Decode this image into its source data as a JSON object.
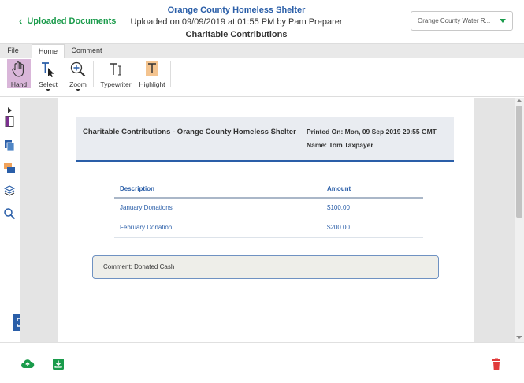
{
  "header": {
    "back_label": "Uploaded Documents",
    "title": "Orange County Homeless Shelter",
    "subtitle": "Uploaded on 09/09/2019 at 01:55 PM by Pam Preparer",
    "category": "Charitable Contributions",
    "dropdown_value": "Orange County Water R..."
  },
  "tabs": [
    {
      "label": "File"
    },
    {
      "label": "Home"
    },
    {
      "label": "Comment"
    }
  ],
  "tools": {
    "hand": "Hand",
    "select": "Select",
    "zoom": "Zoom",
    "typewriter": "Typewriter",
    "highlight": "Highlight"
  },
  "sidebar_icons": [
    "expand-panel-icon",
    "bookmark-icon",
    "pages-icon",
    "comments-icon",
    "layers-icon",
    "search-icon"
  ],
  "document": {
    "title": "Charitable Contributions - Orange County Homeless Shelter",
    "printed_on": "Printed On: Mon, 09 Sep 2019 20:55 GMT",
    "name": "Name: Tom Taxpayer",
    "table": {
      "headers": [
        "Description",
        "Amount"
      ],
      "rows": [
        {
          "description": "January Donations",
          "amount": "$100.00"
        },
        {
          "description": "February Donation",
          "amount": "$200.00"
        }
      ]
    },
    "comment": "Comment: Donated Cash"
  },
  "colors": {
    "accent_green": "#1a9b4b",
    "accent_blue": "#2a5ea8",
    "hand_active": "#d9b6d9",
    "delete_red": "#e03a3a"
  }
}
